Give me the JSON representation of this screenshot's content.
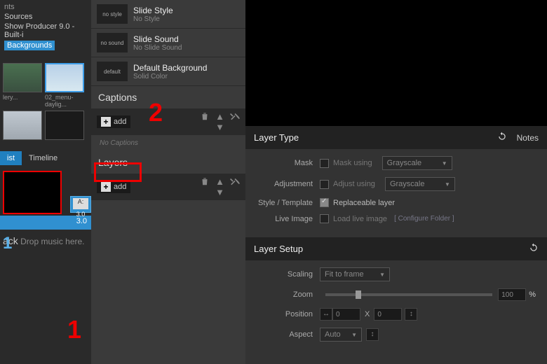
{
  "left": {
    "tree": {
      "sources": "Sources",
      "producer": "Show Producer 9.0 - Built-i",
      "backgrounds": "Backgrounds"
    },
    "thumb_labels": {
      "gallery": "lery...",
      "menu": "02_menu-daylig..."
    },
    "tabs": {
      "list": "ist",
      "timeline": "Timeline"
    },
    "track": {
      "mini": "A:",
      "dur1": "3.0",
      "dur2": "3.0",
      "label": "ack",
      "hint": "Drop music here."
    }
  },
  "slide_props": [
    {
      "swatch": "no style",
      "title": "Slide Style",
      "sub": "No Style"
    },
    {
      "swatch": "no sound",
      "title": "Slide Sound",
      "sub": "No Slide Sound"
    },
    {
      "swatch": "default",
      "title": "Default Background",
      "sub": "Solid Color"
    }
  ],
  "sections": {
    "captions": {
      "title": "Captions",
      "add": "add",
      "empty": "No Captions"
    },
    "layers": {
      "title": "Layers",
      "add": "add"
    }
  },
  "annotations": {
    "one": "1",
    "two": "2"
  },
  "layer_type": {
    "header": "Layer Type",
    "notes": "Notes",
    "mask_label": "Mask",
    "mask_chk": "Mask using",
    "mask_sel": "Grayscale",
    "adj_label": "Adjustment",
    "adj_chk": "Adjust using",
    "adj_sel": "Grayscale",
    "style_label": "Style / Template",
    "style_chk": "Replaceable layer",
    "live_label": "Live Image",
    "live_chk": "Load live image",
    "live_link": "[ Configure Folder ]"
  },
  "layer_setup": {
    "header": "Layer Setup",
    "scaling_label": "Scaling",
    "scaling_sel": "Fit to frame",
    "zoom_label": "Zoom",
    "zoom_val": "100",
    "zoom_pct": "%",
    "pos_label": "Position",
    "pos_x": "0",
    "pos_xlabel": "X",
    "pos_y": "0",
    "aspect_label": "Aspect",
    "aspect_sel": "Auto"
  }
}
